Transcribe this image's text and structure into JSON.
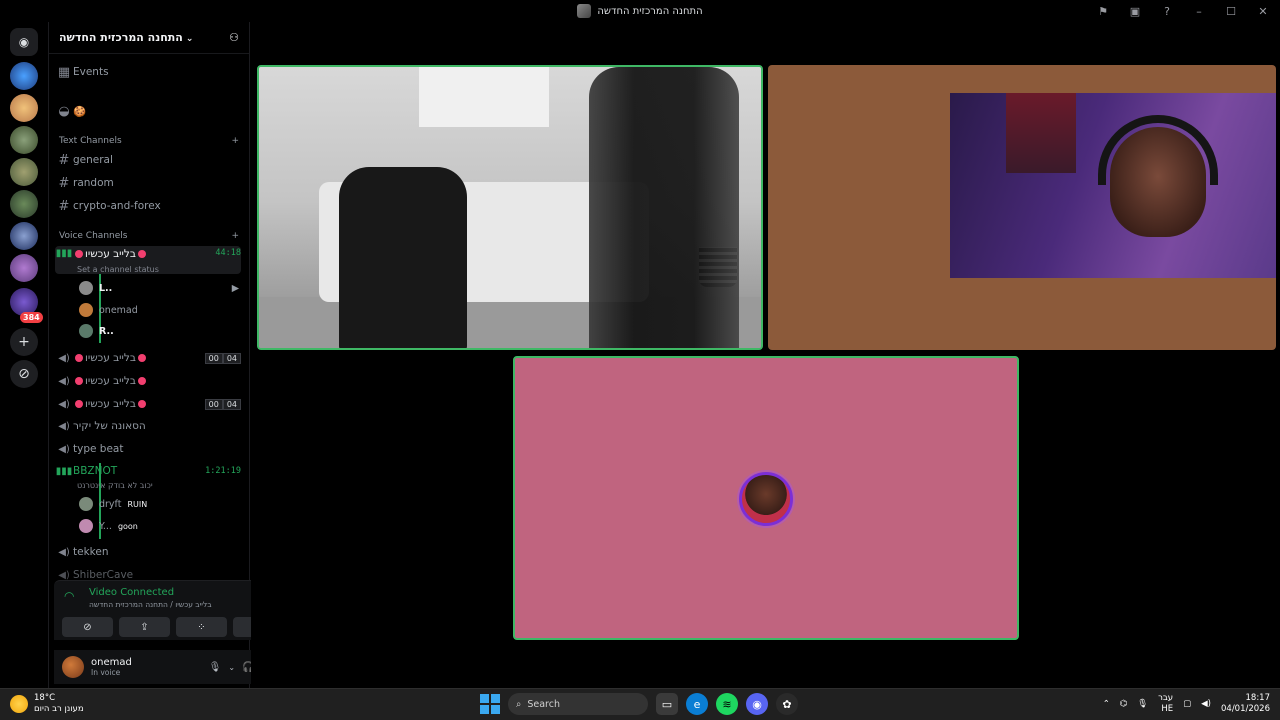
{
  "window": {
    "title": "התחנה המרכזית החדשה",
    "controls": [
      "minimize-icon",
      "maximize-icon",
      "close-icon"
    ]
  },
  "server": {
    "name": "התחנה המרכזית החדשה",
    "events_label": "Events",
    "badge_count": "384"
  },
  "text_category": "Text Channels",
  "text_channels": [
    "general",
    "random",
    "crypto-and-forex"
  ],
  "voice_category": "Voice Channels",
  "voice_channels": [
    {
      "name": "בלייב עכשיו",
      "status": "Set a channel status",
      "timer": "44:18"
    },
    {
      "name": "בלייב עכשיו",
      "count_a": "00",
      "count_b": "04"
    },
    {
      "name": "בלייב עכשיו"
    },
    {
      "name": "בלייב עכשיו",
      "count_a": "00",
      "count_b": "04"
    },
    {
      "name": "הסאונה של יקיר"
    },
    {
      "name": "type beat"
    },
    {
      "name": "BBZNOT",
      "status": "יכוב לא בודק אינטרנט",
      "timer": "1:21:19"
    },
    {
      "name": "tekken"
    },
    {
      "name": "ShiberCave"
    }
  ],
  "vc1_members": [
    "L..",
    "onemad",
    "R.."
  ],
  "vc7_members": [
    {
      "name": "dryft",
      "tag": "RUIN"
    },
    {
      "name": "Y...",
      "tag": "goon"
    }
  ],
  "voice_panel": {
    "status": "Video Connected",
    "location": "בלייב עכשיו / התחנה המרכזית החדשה"
  },
  "user": {
    "name": "onemad",
    "status": "In voice"
  },
  "taskbar": {
    "temp": "18°C",
    "weather_desc": "מעונן רב היום",
    "search_label": "Search",
    "lang_top": "עבר",
    "lang_bottom": "HE",
    "time": "18:17",
    "date": "04/01/2026"
  },
  "colors": {
    "speaking_green": "#23a55a",
    "tile2_bg": "#8c5a3a",
    "tile3_bg": "#c0647f",
    "live_red": "#f23f6f"
  }
}
